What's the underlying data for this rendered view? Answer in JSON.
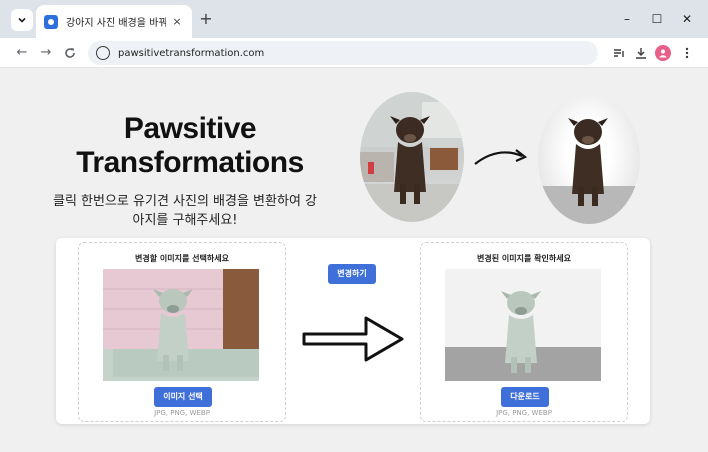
{
  "browser": {
    "tab_title": "강아지 사진 배경을 바꿔보세요!",
    "tab_close": "×",
    "new_tab": "+",
    "url": "pawsitivetransformation.com",
    "window_controls": {
      "minimize": "–",
      "maximize": "☐",
      "close": "✕"
    }
  },
  "hero": {
    "title": "Pawsitive Transformations",
    "subtitle": "클릭 한번으로 유기견 사진의 배경을 변환하여 강아지를 구해주세요!"
  },
  "converter": {
    "upload_title": "변경할 이미지를 선택하세요",
    "select_button": "이미지 선택",
    "upload_formats": "JPG, PNG, WEBP",
    "convert_button": "변경하기",
    "result_title": "변경된 이미지를 확인하세요",
    "download_button": "다운로드",
    "result_formats": "JPG, PNG, WEBP"
  },
  "colors": {
    "accent": "#3f6fd8",
    "page_background": "#f0f0f0",
    "tabbar": "#dee3ea"
  },
  "icons": [
    "tab-search-icon",
    "favicon-icon",
    "back-icon",
    "forward-icon",
    "reload-icon",
    "site-info-icon",
    "reading-list-icon",
    "download-icon",
    "profile-icon",
    "menu-icon",
    "curved-arrow-icon",
    "big-right-arrow-icon"
  ]
}
